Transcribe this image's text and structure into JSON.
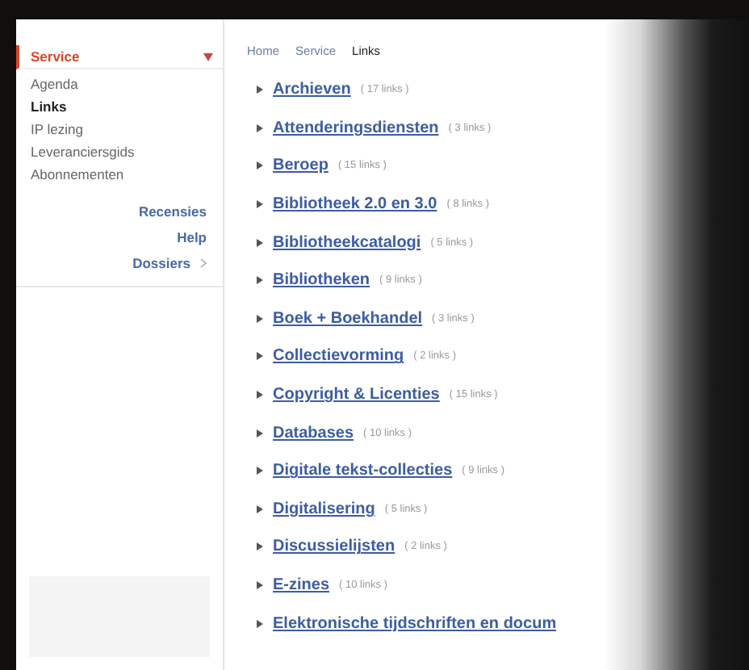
{
  "sidebar": {
    "menu": [
      {
        "label": "Service",
        "selected": true,
        "bold": false
      },
      {
        "label": "Agenda",
        "selected": false,
        "bold": false
      },
      {
        "label": "Links",
        "selected": false,
        "bold": true
      },
      {
        "label": "IP lezing",
        "selected": false,
        "bold": false
      },
      {
        "label": "Leveranciersgids",
        "selected": false,
        "bold": false
      },
      {
        "label": "Abonnementen",
        "selected": false,
        "bold": false
      }
    ],
    "links": [
      {
        "label": "Recensies",
        "submenu": false
      },
      {
        "label": "Help",
        "submenu": false
      },
      {
        "label": "Dossiers",
        "submenu": true
      }
    ]
  },
  "breadcrumb": [
    "Home",
    "Service",
    "Links"
  ],
  "categories": [
    {
      "name": "Archieven",
      "count": "( 17 links )"
    },
    {
      "name": "Attenderingsdiensten",
      "count": "( 3 links )"
    },
    {
      "name": "Beroep",
      "count": "( 15 links )"
    },
    {
      "name": "Bibliotheek 2.0 en 3.0",
      "count": "( 8 links )"
    },
    {
      "name": "Bibliotheekcatalogi",
      "count": "( 5 links )"
    },
    {
      "name": "Bibliotheken",
      "count": "( 9 links )"
    },
    {
      "name": "Boek + Boekhandel",
      "count": "( 3 links )"
    },
    {
      "name": "Collectievorming",
      "count": "( 2 links )"
    },
    {
      "name": "Copyright & Licenties",
      "count": "( 15 links )"
    },
    {
      "name": "Databases",
      "count": "( 10 links )"
    },
    {
      "name": "Digitale tekst-collecties",
      "count": "( 9 links )"
    },
    {
      "name": "Digitalisering",
      "count": "( 5 links )"
    },
    {
      "name": "Discussielijsten",
      "count": "( 2 links )"
    },
    {
      "name": "E-zines",
      "count": "( 10 links )"
    },
    {
      "name": "Elektronische tijdschriften en docum"
    }
  ]
}
